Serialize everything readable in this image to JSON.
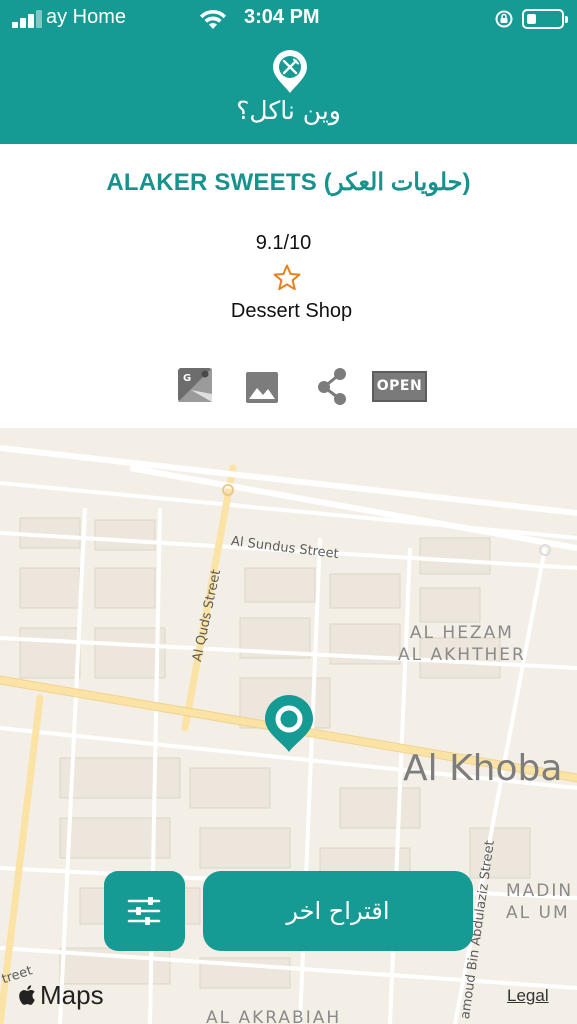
{
  "status_bar": {
    "carrier": "ay Home",
    "time": "3:04 PM"
  },
  "header": {
    "title": "وين ناكل؟"
  },
  "restaurant": {
    "name": "ALAKER SWEETS (حلويات العكر)",
    "rating": "9.1/10",
    "category": "Dessert Shop",
    "open_label": "OPEN"
  },
  "actions": [
    {
      "icon": "google-maps-icon"
    },
    {
      "icon": "photo-icon"
    },
    {
      "icon": "share-icon"
    },
    {
      "icon": "open-badge"
    }
  ],
  "map": {
    "streets": {
      "sundus": "Al Sundus Street",
      "quds": "Al Quds Street",
      "abdulaziz": "amoud Bin Abdulaziz Street",
      "corner": "treet"
    },
    "districts": {
      "hezam_line1": "AL HEZAM",
      "hezam_line2": "AL AKHTHER",
      "madin_line1": "MADIN",
      "madin_line2": "AL UM",
      "akrabiah": "AL AKRABIAH"
    },
    "city": "Al Khoba",
    "attribution": "Maps",
    "legal": "Legal"
  },
  "buttons": {
    "suggest_another": "اقتراح اخر"
  },
  "colors": {
    "primary": "#159a94",
    "title_text": "#17928d",
    "star": "#e8801c",
    "map_bg": "#f4efe6",
    "major_road": "#fbe3a6"
  }
}
